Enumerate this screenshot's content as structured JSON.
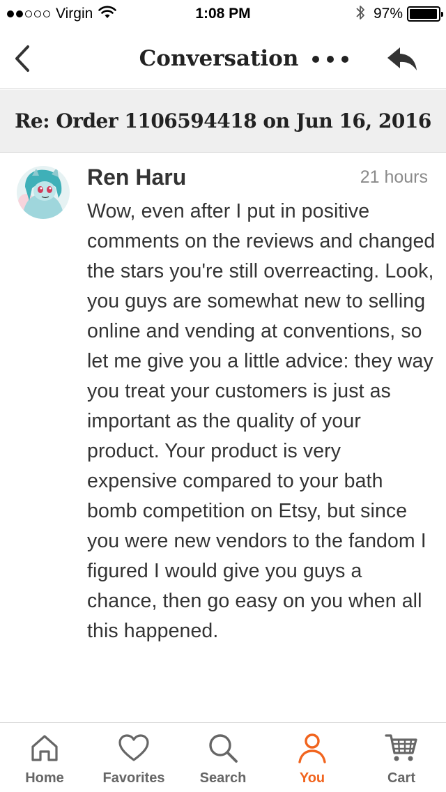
{
  "status_bar": {
    "signal_bars_filled": 2,
    "signal_bars_total": 5,
    "carrier": "Virgin",
    "time": "1:08 PM",
    "battery_percent": "97%",
    "battery_level": 0.97
  },
  "nav": {
    "title": "Conversation",
    "back_icon": "chevron-left-icon",
    "more_icon": "more-horizontal-icon",
    "reply_icon": "reply-icon"
  },
  "subject": {
    "text": "Re: Order 1106594418 on Jun 16, 2016"
  },
  "message": {
    "sender": "Ren Haru",
    "time": "21 hours",
    "body": "Wow, even after I put in positive comments on the reviews and changed the stars you're still overreacting. Look, you guys are somewhat new to selling online and vending at conventions, so let me give you a little advice: they way you treat your customers is just as important as the quality of your product. Your product is very expensive compared to your bath bomb competition on Etsy, but since you were new vendors to the fandom I figured I would give you guys a chance, then go easy on you when all this happened."
  },
  "tab_bar": {
    "tabs": [
      {
        "label": "Home",
        "icon": "home-icon"
      },
      {
        "label": "Favorites",
        "icon": "heart-icon"
      },
      {
        "label": "Search",
        "icon": "search-icon"
      },
      {
        "label": "You",
        "icon": "user-icon"
      },
      {
        "label": "Cart",
        "icon": "cart-icon"
      }
    ],
    "active": "You"
  },
  "colors": {
    "accent": "#f1641e",
    "tab_inactive": "#666666",
    "subject_background": "#efefef",
    "timestamp": "#8a8a8a"
  }
}
